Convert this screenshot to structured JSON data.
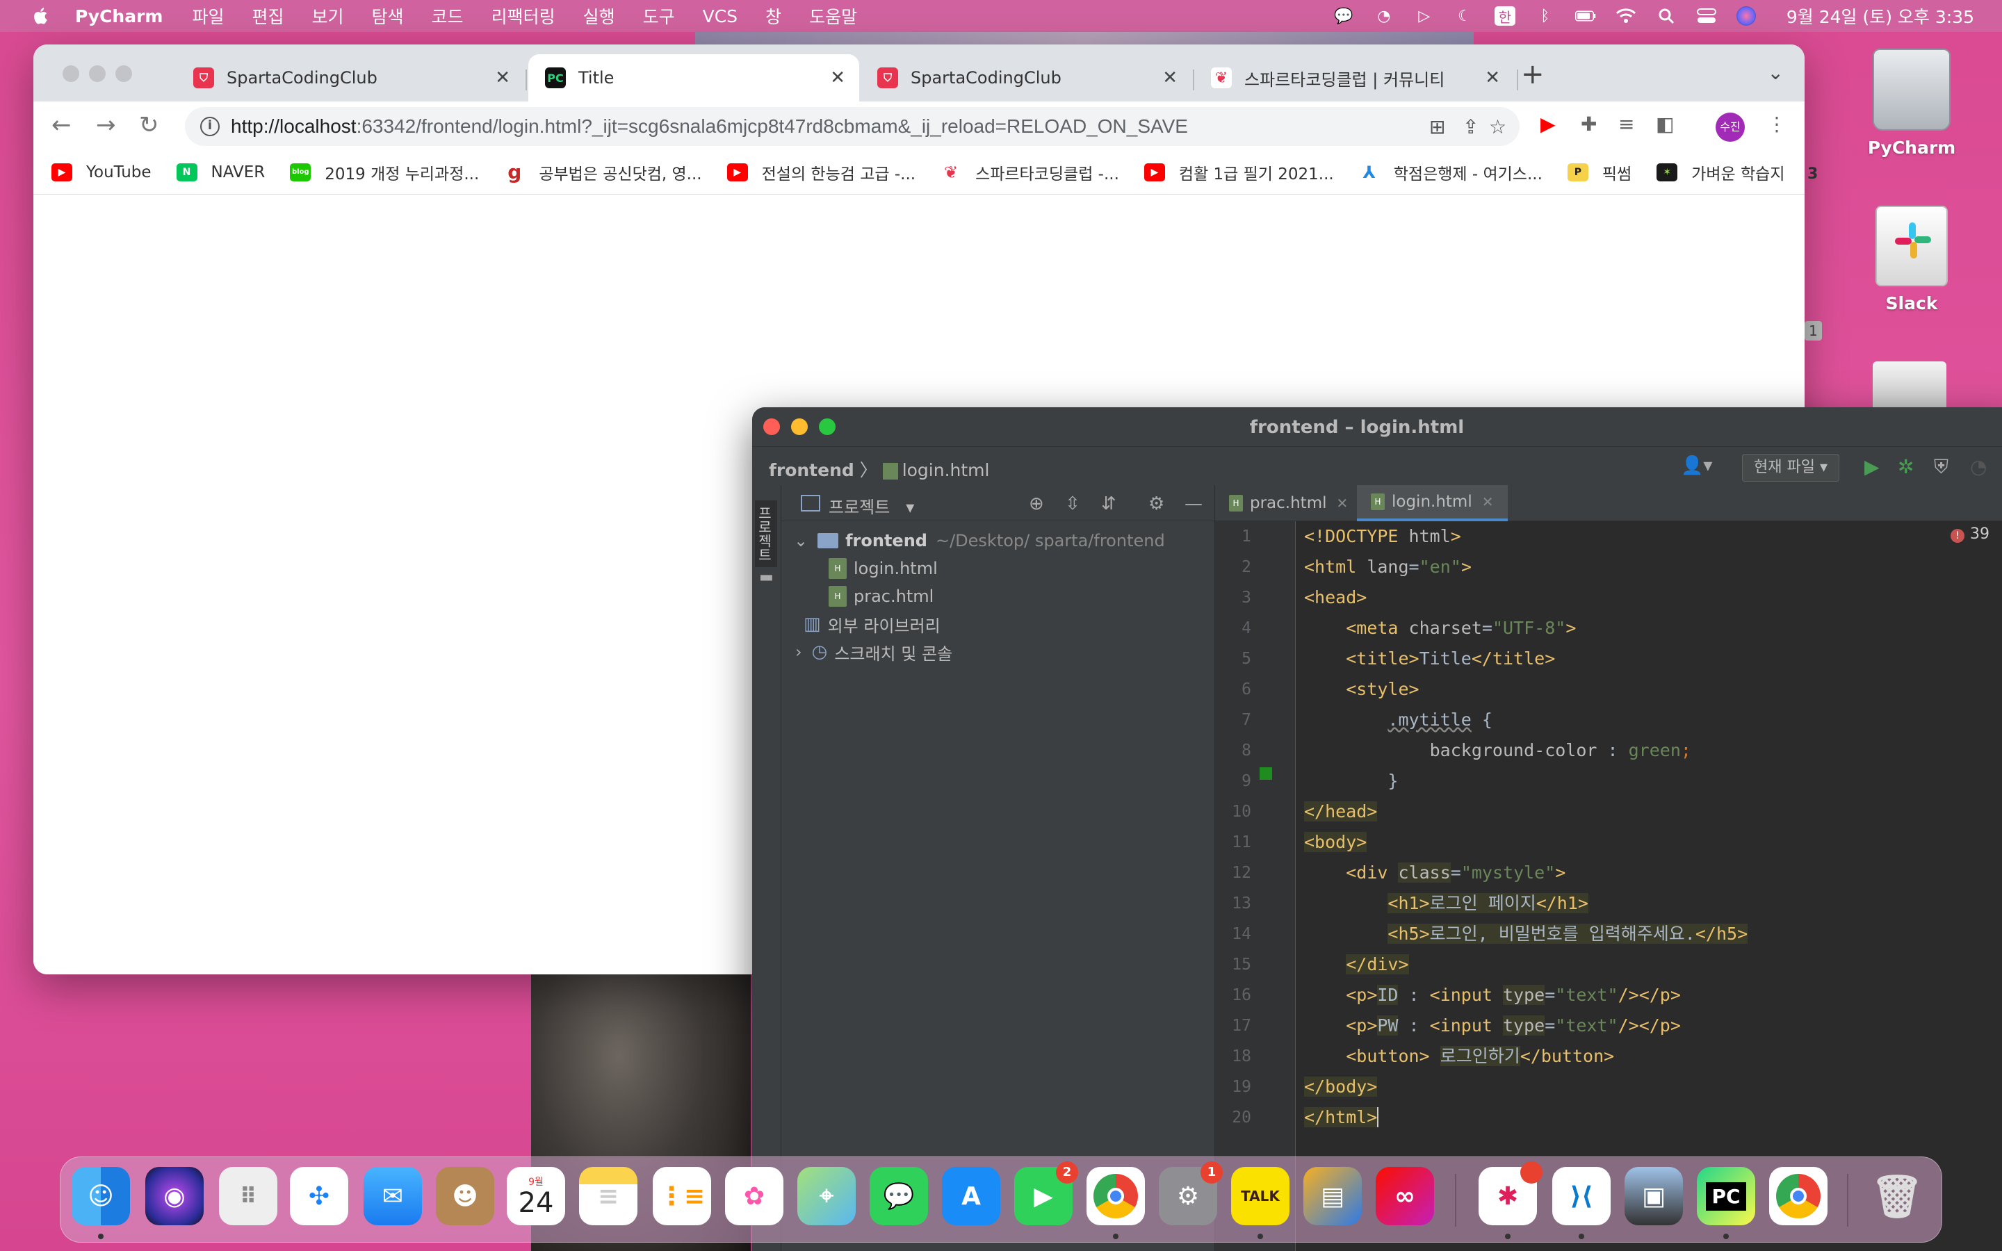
{
  "menubar": {
    "app": "PyCharm",
    "items": [
      "파일",
      "편집",
      "보기",
      "탐색",
      "코드",
      "리팩터링",
      "실행",
      "도구",
      "VCS",
      "창",
      "도움말"
    ],
    "input_source": "한",
    "clock": "9월 24일 (토) 오후 3:35"
  },
  "desktop": {
    "icons": [
      {
        "label": "PyCharm"
      },
      {
        "label": "Slack"
      }
    ],
    "edge_text_1": "3",
    "edge_text_2": "1"
  },
  "chrome": {
    "tabs": [
      {
        "title": "SpartaCodingClub",
        "active": false
      },
      {
        "title": "Title",
        "active": true
      },
      {
        "title": "SpartaCodingClub",
        "active": false
      },
      {
        "title": "스파르타코딩클럽 | 커뮤니티",
        "active": false
      }
    ],
    "new_tab": "+",
    "url_host": "http://localhost",
    "url_rest": ":63342/frontend/login.html?_ijt=scg6snala6mjcp8t47rd8cbmam&_ij_reload=RELOAD_ON_SAVE",
    "avatar": "수진",
    "bookmarks": [
      {
        "label": "YouTube",
        "color": "#ff0000"
      },
      {
        "label": "NAVER",
        "color": "#03c75a"
      },
      {
        "label": "2019 개정 누리과정...",
        "color": "#1ec800"
      },
      {
        "label": "공부법은 공신닷컴, 영...",
        "color": "#c62828"
      },
      {
        "label": "전설의 한능검 고급 -...",
        "color": "#ff0000"
      },
      {
        "label": "스파르타코딩클럽 -...",
        "color": "#e8344e"
      },
      {
        "label": "컴활 1급 필기 2021...",
        "color": "#ff0000"
      },
      {
        "label": "학점은행제 - 여기스...",
        "color": "#1e88e5"
      },
      {
        "label": "픽썸",
        "color": "#222222"
      },
      {
        "label": "가벼운 학습지",
        "color": "#1a1a1a"
      }
    ]
  },
  "pycharm": {
    "title": "frontend – login.html",
    "crumb_project": "frontend",
    "crumb_file": "login.html",
    "run_config": "현재 파일",
    "side_label": "프로젝트",
    "project_panel_label": "프로젝트",
    "tree": {
      "root": "frontend",
      "root_path": "~/Desktop/ sparta/frontend",
      "files": [
        "login.html",
        "prac.html"
      ],
      "ext_libs": "외부 라이브러리",
      "scratches": "스크래치 및 콘솔"
    },
    "editor_tabs": [
      {
        "name": "prac.html",
        "active": false
      },
      {
        "name": "login.html",
        "active": true
      }
    ],
    "error_count": "39",
    "line_numbers": [
      "1",
      "2",
      "3",
      "4",
      "5",
      "6",
      "7",
      "8",
      "9",
      "10",
      "11",
      "12",
      "13",
      "14",
      "15",
      "16",
      "17",
      "18",
      "19",
      "20"
    ]
  },
  "dock": {
    "calendar_month": "9월",
    "calendar_day": "24",
    "facetime_badge": "2",
    "settings_badge": "1",
    "kakao": "TALK",
    "pycharm_label": "PC"
  }
}
